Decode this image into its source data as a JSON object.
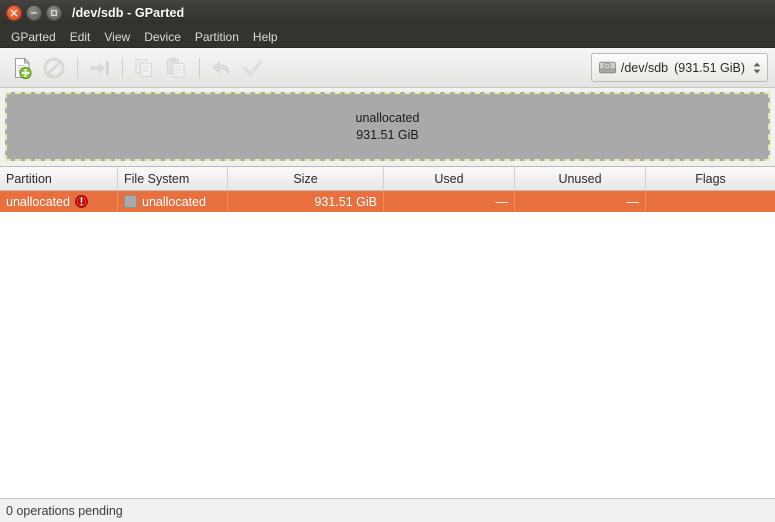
{
  "window": {
    "title": "/dev/sdb - GParted",
    "controls": [
      {
        "name": "close",
        "glyph": "×"
      },
      {
        "name": "minimize",
        "glyph": "−"
      },
      {
        "name": "maximize",
        "glyph": "□"
      }
    ]
  },
  "menubar": {
    "items": [
      {
        "label": "GParted"
      },
      {
        "label": "Edit"
      },
      {
        "label": "View"
      },
      {
        "label": "Device"
      },
      {
        "label": "Partition"
      },
      {
        "label": "Help"
      }
    ]
  },
  "toolbar": {
    "buttons": [
      {
        "icon": "new-partition-icon",
        "label": "New",
        "enabled": true
      },
      {
        "icon": "delete-partition-icon",
        "label": "Delete",
        "enabled": false
      },
      {
        "icon": "resize-move-icon",
        "label": "Resize/Move",
        "enabled": false
      },
      {
        "icon": "copy-icon",
        "label": "Copy",
        "enabled": false
      },
      {
        "icon": "paste-icon",
        "label": "Paste",
        "enabled": false
      },
      {
        "icon": "undo-icon",
        "label": "Undo",
        "enabled": false
      },
      {
        "icon": "apply-icon",
        "label": "Apply",
        "enabled": false
      }
    ],
    "device_selector": {
      "icon": "hard-disk-icon",
      "device": "/dev/sdb",
      "size": "(931.51 GiB)"
    }
  },
  "graphic": {
    "partition_name": "unallocated",
    "partition_size": "931.51 GiB",
    "fill_color": "#a9a9a9",
    "border_color": "#e9e9a4"
  },
  "table": {
    "columns": [
      {
        "label": "Partition",
        "align": "left"
      },
      {
        "label": "File System",
        "align": "left"
      },
      {
        "label": "Size",
        "align": "center"
      },
      {
        "label": "Used",
        "align": "center"
      },
      {
        "label": "Unused",
        "align": "center"
      },
      {
        "label": "Flags",
        "align": "center"
      }
    ],
    "rows": [
      {
        "partition": "unallocated",
        "warning_icon": "warning-icon",
        "file_system": "unallocated",
        "fs_color": "#a9a9a9",
        "size": "931.51 GiB",
        "used": "—",
        "unused": "—",
        "flags": "",
        "selected": true,
        "selected_color": "#e8703f"
      }
    ]
  },
  "statusbar": {
    "message": "0 operations pending"
  }
}
